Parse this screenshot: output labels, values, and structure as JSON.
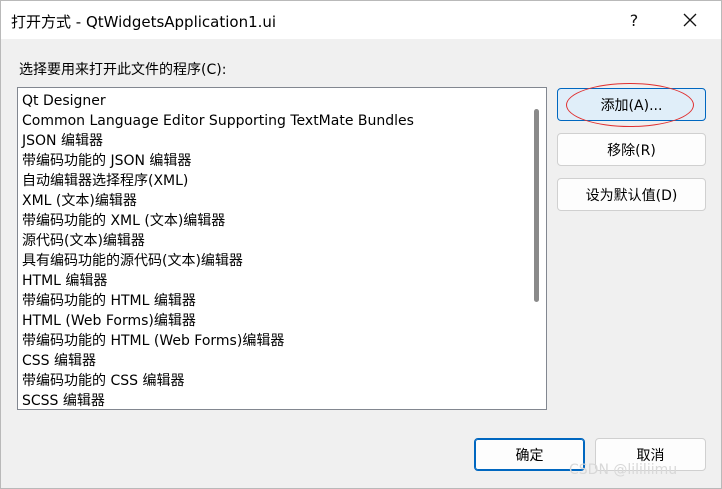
{
  "window": {
    "title": "打开方式 - QtWidgetsApplication1.ui",
    "help_glyph": "?",
    "close_icon": "close-icon"
  },
  "prompt": "选择要用来打开此文件的程序(C):",
  "programs": [
    "Qt Designer",
    "Common Language Editor Supporting TextMate Bundles",
    "JSON 编辑器",
    "带编码功能的 JSON 编辑器",
    "自动编辑器选择程序(XML)",
    "XML (文本)编辑器",
    "带编码功能的 XML (文本)编辑器",
    "源代码(文本)编辑器",
    "具有编码功能的源代码(文本)编辑器",
    "HTML 编辑器",
    "带编码功能的 HTML 编辑器",
    "HTML (Web Forms)编辑器",
    "带编码功能的 HTML (Web Forms)编辑器",
    "CSS 编辑器",
    "带编码功能的 CSS 编辑器",
    "SCSS 编辑器"
  ],
  "buttons": {
    "add": "添加(A)...",
    "remove": "移除(R)",
    "set_default": "设为默认值(D)",
    "ok": "确定",
    "cancel": "取消"
  },
  "watermark": "CSDN @lililiimu",
  "colors": {
    "accent": "#0067c0",
    "annotation": "#e03030"
  }
}
